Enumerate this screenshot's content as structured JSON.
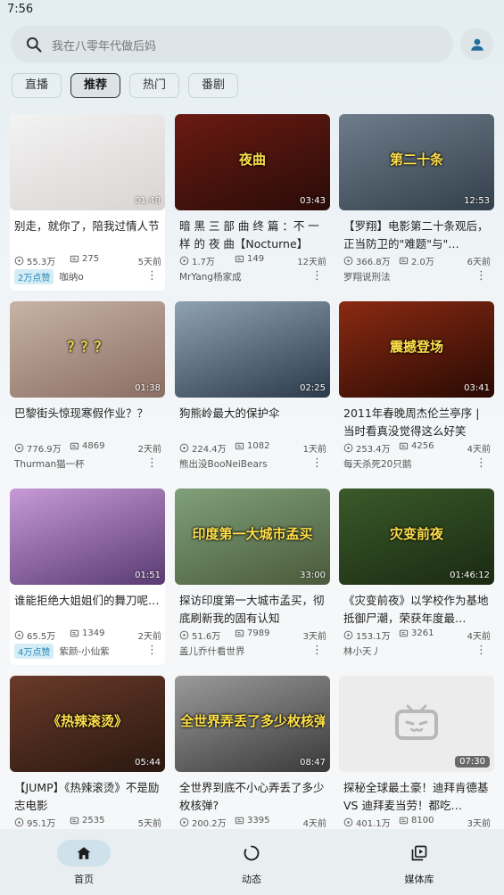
{
  "status_bar": {
    "time": "7:56"
  },
  "search": {
    "placeholder": "我在八零年代做后妈"
  },
  "icons": {
    "search": "search-icon",
    "avatar": "person-icon"
  },
  "tabs": [
    {
      "label": "直播",
      "active": false
    },
    {
      "label": "推荐",
      "active": true
    },
    {
      "label": "热门",
      "active": false
    },
    {
      "label": "番剧",
      "active": false
    }
  ],
  "videos": [
    {
      "title": "别走，就你了，陪我过情人节",
      "duration": "01:48",
      "views": "55.3万",
      "danmaku": "275",
      "date": "5天前",
      "badge": "2万点赞",
      "author": "咖纳o",
      "thumb_colors": [
        "#f3f3f3",
        "#d8d4d2"
      ]
    },
    {
      "title": "暗 黑 三 部 曲 终 篇 ：不 一 样 的 夜 曲【Nocturne】",
      "duration": "03:43",
      "views": "1.7万",
      "danmaku": "149",
      "date": "12天前",
      "badge": "",
      "author": "MrYang杨家成",
      "thumb_colors": [
        "#6a1a12",
        "#2a0c08"
      ],
      "overlay_text": "夜曲"
    },
    {
      "title": "【罗翔】电影第二十条观后，正当防卫的\"难题\"与\"…",
      "duration": "12:53",
      "views": "366.8万",
      "danmaku": "2.0万",
      "date": "6天前",
      "badge": "",
      "author": "罗翔说刑法",
      "thumb_colors": [
        "#6f7c8a",
        "#33404c"
      ],
      "overlay_text": "第二十条"
    },
    {
      "title": "巴黎街头惊现寒假作业？？",
      "duration": "01:38",
      "views": "776.9万",
      "danmaku": "4869",
      "date": "2天前",
      "badge": "",
      "author": "Thurman猫一杯",
      "thumb_colors": [
        "#c7b3a6",
        "#8b6e63"
      ],
      "overlay_text": "？？？"
    },
    {
      "title": "狗熊岭最大的保护伞",
      "duration": "02:25",
      "views": "224.4万",
      "danmaku": "1082",
      "date": "1天前",
      "badge": "",
      "author": "熊出没BooNeiBears",
      "thumb_colors": [
        "#8fa2b4",
        "#2b3a4a"
      ]
    },
    {
      "title": "2011年春晚周杰伦兰亭序 | 当时看真没觉得这么好笑",
      "duration": "03:41",
      "views": "253.4万",
      "danmaku": "4256",
      "date": "4天前",
      "badge": "",
      "author": "每天杀死20只鹅",
      "thumb_colors": [
        "#8a2a12",
        "#2a0a04"
      ],
      "overlay_text": "震撼登场"
    },
    {
      "title": "谁能拒绝大姐姐们的舞刀呢…",
      "duration": "01:51",
      "views": "65.5万",
      "danmaku": "1349",
      "date": "2天前",
      "badge": "4万点赞",
      "author": "紫颜-小仙紫",
      "thumb_colors": [
        "#c69ad6",
        "#5a3a72"
      ]
    },
    {
      "title": "探访印度第一大城市孟买，彻底刷新我的固有认知",
      "duration": "33:00",
      "views": "51.6万",
      "danmaku": "7989",
      "date": "3天前",
      "badge": "",
      "author": "盖儿乔什看世界",
      "thumb_colors": [
        "#7fa07a",
        "#4a5a3a"
      ],
      "overlay_text": "印度第一大城市孟买"
    },
    {
      "title": "《灾变前夜》以学校作为基地抵御尸潮，荣获年度最…",
      "duration": "01:46:12",
      "views": "153.1万",
      "danmaku": "3261",
      "date": "4天前",
      "badge": "",
      "author": "林小天丿",
      "thumb_colors": [
        "#3a5a2a",
        "#1a2a12"
      ],
      "overlay_text": "灾变前夜"
    },
    {
      "title": "【JUMP】《热辣滚烫》不是励志电影",
      "duration": "05:44",
      "views": "95.1万",
      "danmaku": "2535",
      "date": "5天前",
      "badge": "",
      "author": "",
      "thumb_colors": [
        "#6a3a2a",
        "#2a1810"
      ],
      "overlay_text": "《热辣滚烫》"
    },
    {
      "title": "全世界到底不小心弄丢了多少枚核弹?",
      "duration": "08:47",
      "views": "200.2万",
      "danmaku": "3395",
      "date": "4天前",
      "badge": "",
      "author": "",
      "thumb_colors": [
        "#9a9a9a",
        "#3a3a3a"
      ],
      "overlay_text": "全世界弄丢了多少枚核弹?"
    },
    {
      "title": "探秘全球最土豪！迪拜肯德基 VS 迪拜麦当劳！都吃…",
      "duration": "07:30",
      "views": "401.1万",
      "danmaku": "8100",
      "date": "3天前",
      "badge": "",
      "author": "",
      "thumb_colors": [
        "#ececec",
        "#ececec"
      ],
      "placeholder": true
    }
  ],
  "bottom_nav": [
    {
      "label": "首页",
      "icon": "home-icon",
      "active": true
    },
    {
      "label": "动态",
      "icon": "activity-icon",
      "active": false
    },
    {
      "label": "媒体库",
      "icon": "library-icon",
      "active": false
    }
  ]
}
